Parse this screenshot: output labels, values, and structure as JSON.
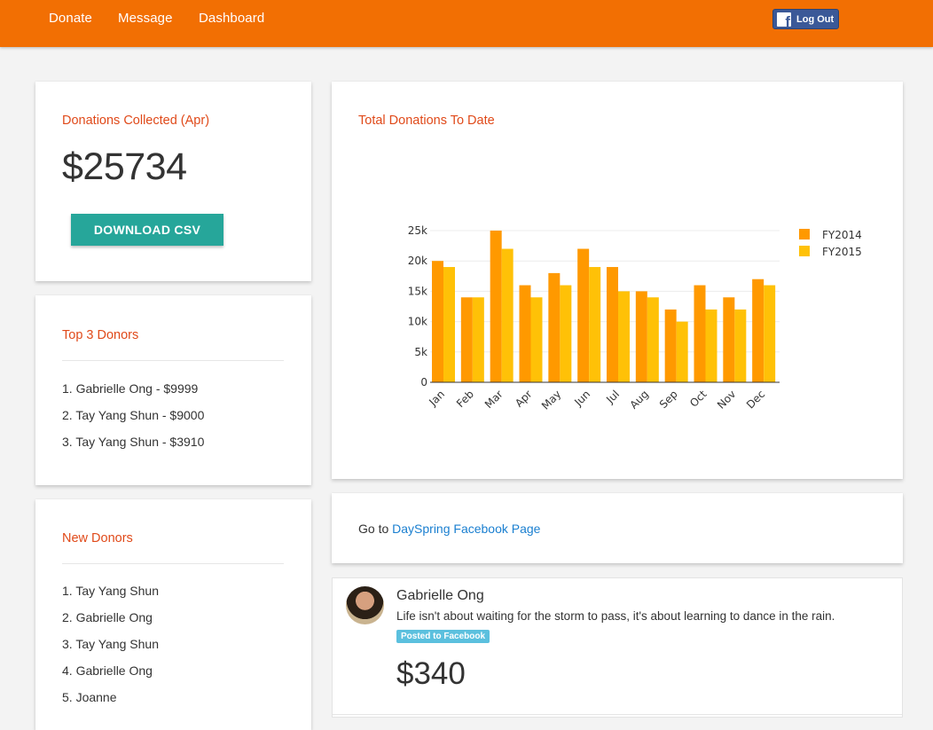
{
  "nav": {
    "links": [
      "Donate",
      "Message",
      "Dashboard"
    ],
    "logout_label": "Log Out",
    "fb_logo": "f"
  },
  "donations_card": {
    "title": "Donations Collected (Apr)",
    "amount": "$25734",
    "download_label": "DOWNLOAD CSV"
  },
  "top_donors": {
    "title": "Top 3 Donors",
    "items": [
      "1. Gabrielle Ong - $9999",
      "2. Tay Yang Shun - $9000",
      "3. Tay Yang Shun - $3910"
    ]
  },
  "new_donors": {
    "title": "New Donors",
    "items": [
      "1. Tay Yang Shun",
      "2. Gabrielle Ong",
      "3. Tay Yang Shun",
      "4. Gabrielle Ong",
      "5. Joanne"
    ]
  },
  "chart_card": {
    "title": "Total Donations To Date"
  },
  "chart_data": {
    "type": "bar",
    "title": "Total Donations To Date",
    "categories": [
      "Jan",
      "Feb",
      "Mar",
      "Apr",
      "May",
      "Jun",
      "Jul",
      "Aug",
      "Sep",
      "Oct",
      "Nov",
      "Dec"
    ],
    "series": [
      {
        "name": "FY2014",
        "color": "#ff9900",
        "values": [
          20000,
          14000,
          25000,
          16000,
          18000,
          22000,
          19000,
          15000,
          12000,
          16000,
          14000,
          17000
        ]
      },
      {
        "name": "FY2015",
        "color": "#ffc107",
        "values": [
          19000,
          14000,
          22000,
          14000,
          16000,
          19000,
          15000,
          14000,
          10000,
          12000,
          12000,
          16000
        ]
      }
    ],
    "yticks": [
      "0",
      "5k",
      "10k",
      "15k",
      "20k",
      "25k"
    ],
    "ylim": [
      0,
      25000
    ],
    "grid": true,
    "legend": "top-right"
  },
  "facebook_card": {
    "prefix": "Go to ",
    "link_text": "DaySpring Facebook Page"
  },
  "post": {
    "name": "Gabrielle Ong",
    "text": "Life isn't about waiting for the storm to pass, it's about learning to dance in the rain.",
    "badge": "Posted to Facebook",
    "amount": "$340"
  }
}
